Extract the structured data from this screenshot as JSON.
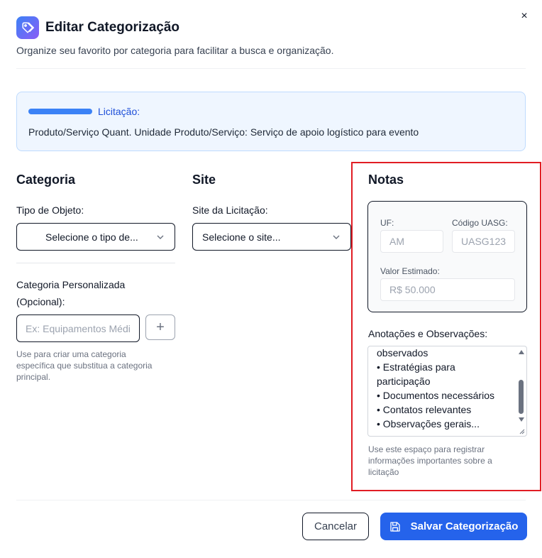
{
  "dialog": {
    "title": "Editar Categorização",
    "subtitle": "Organize seu favorito por categoria para facilitar a busca e organização.",
    "close_icon": "×"
  },
  "licitacao": {
    "label": "Licitação:",
    "text": "Produto/Serviço Quant. Unidade Produto/Serviço: Serviço de apoio logístico para evento"
  },
  "categoria": {
    "title": "Categoria",
    "tipo_label": "Tipo de Objeto:",
    "tipo_select": "Selecione o tipo de...",
    "personalizada_label_1": "Categoria Personalizada",
    "personalizada_label_2": "(Opcional):",
    "personalizada_placeholder": "Ex: Equipamentos Médicos",
    "add_icon": "+",
    "help_1": "Use para criar uma categoria",
    "help_2": "específica que substitua a categoria",
    "help_3": "principal."
  },
  "site": {
    "title": "Site",
    "label": "Site da Licitação:",
    "select": "Selecione o site..."
  },
  "notas": {
    "title": "Notas",
    "uf_label": "UF:",
    "uf_value": "AM",
    "uasg_label": "Código UASG:",
    "uasg_value": "UASG123",
    "valor_label": "Valor Estimado:",
    "valor_value": "R$ 50.000",
    "anotacoes_label": "Anotações e Observações:",
    "anotacoes_lines": [
      "observados",
      "• Estratégias para",
      "participação",
      "• Documentos necessários",
      "• Contatos relevantes",
      "• Observações gerais..."
    ],
    "help_1": "Use este espaço para registrar",
    "help_2": "informações importantes sobre a",
    "help_3": "licitação"
  },
  "footer": {
    "cancel": "Cancelar",
    "save": "Salvar Categorização"
  },
  "colors": {
    "accent": "#2563eb",
    "highlight": "#e11d24",
    "info_bg": "#eff6ff"
  }
}
